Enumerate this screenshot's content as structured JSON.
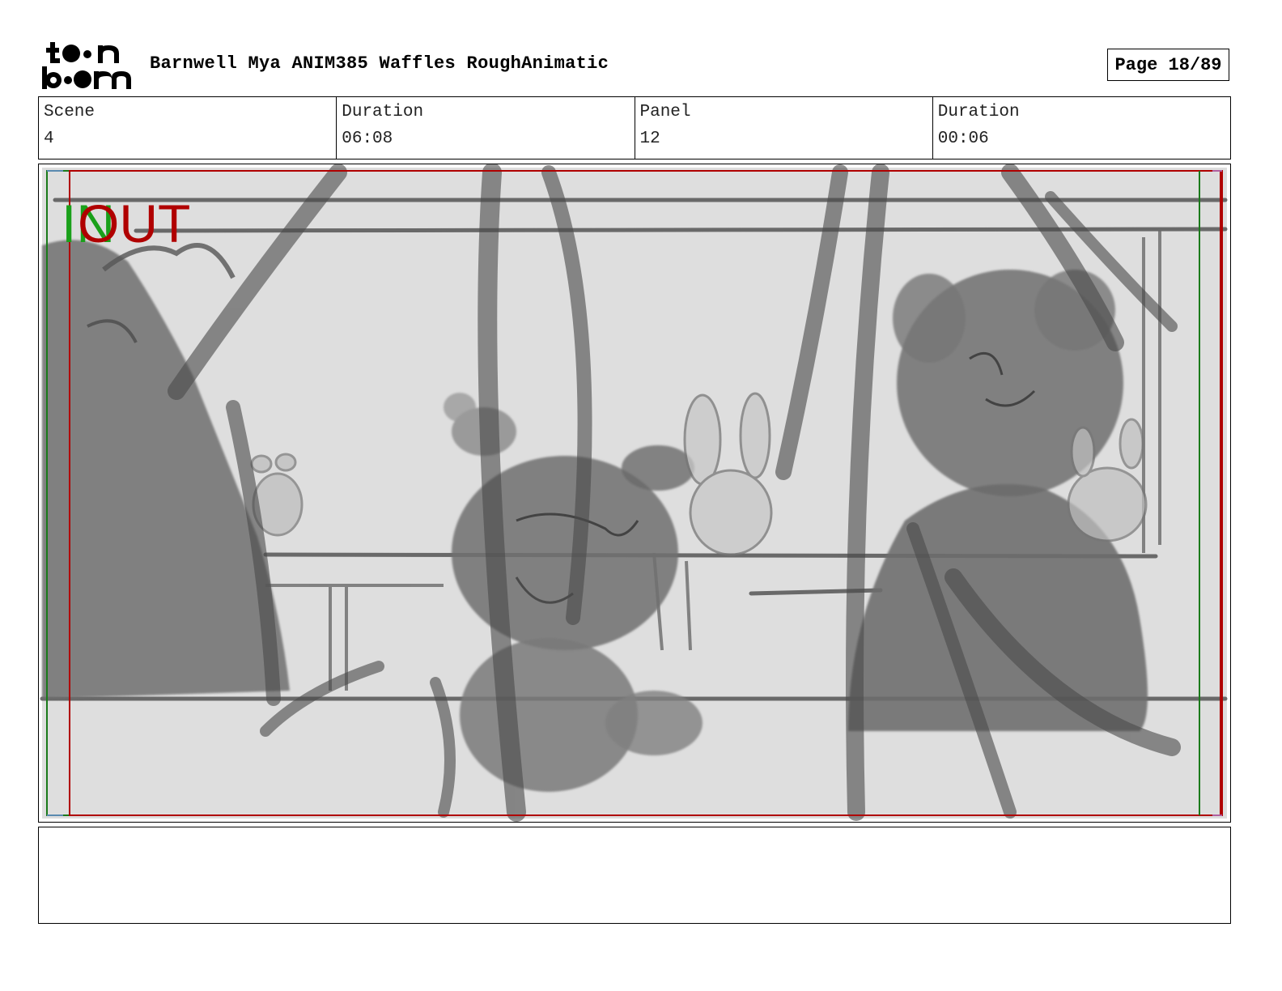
{
  "header": {
    "logo_text": "toon boom",
    "title": "Barnwell Mya ANIM385 Waffles RoughAnimatic",
    "page_label": "Page 18/89"
  },
  "info": {
    "scene_label": "Scene",
    "scene_value": "4",
    "scene_duration_label": "Duration",
    "scene_duration_value": "06:08",
    "panel_label": "Panel",
    "panel_value": "12",
    "panel_duration_label": "Duration",
    "panel_duration_value": "00:06"
  },
  "panel": {
    "in_marker": "IN",
    "out_marker": "OUT",
    "in_color": "#1aa01a",
    "out_color": "#b00000"
  },
  "notes": {
    "text": ""
  }
}
